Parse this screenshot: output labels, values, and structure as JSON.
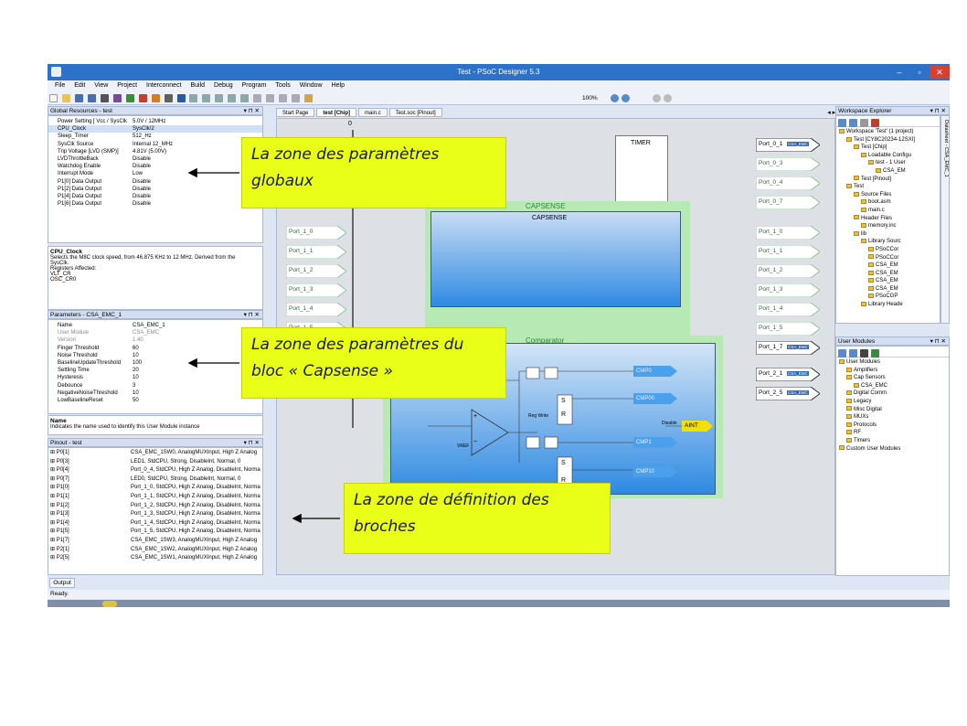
{
  "window": {
    "title": "Test - PSoC Designer 5.3",
    "min": "–",
    "max": "▫",
    "close": "✕"
  },
  "menu": [
    "File",
    "Edit",
    "View",
    "Project",
    "Interconnect",
    "Build",
    "Debug",
    "Program",
    "Tools",
    "Window",
    "Help"
  ],
  "toolbar": {
    "zoom": "100%"
  },
  "global": {
    "title": "Global Resources - test",
    "controls": "▾ ⊓ ✕",
    "rows": [
      {
        "k": "Power Setting [ Vcc / SysClk",
        "v": "5.0V / 12MHz"
      },
      {
        "k": "CPU_Clock",
        "v": "SysClk/2"
      },
      {
        "k": "Sleep_Timer",
        "v": "512_Hz"
      },
      {
        "k": "SysClk Source",
        "v": "Internal 12_MHz"
      },
      {
        "k": "Trip Voltage [LVD (SMP)]",
        "v": "4.81V (5.00V)"
      },
      {
        "k": "LVDThrottleBack",
        "v": "Disable"
      },
      {
        "k": "Watchdog Enable",
        "v": "Disable"
      },
      {
        "k": "Interrupt Mode",
        "v": "Low"
      },
      {
        "k": "P1[0] Data Output",
        "v": "Disable"
      },
      {
        "k": "P1[2] Data Output",
        "v": "Disable"
      },
      {
        "k": "P1[4] Data Output",
        "v": "Disable"
      },
      {
        "k": "P1[6] Data Output",
        "v": "Disable"
      }
    ],
    "desc_title": "CPU_Clock",
    "desc_lines": [
      "Selects the M8C clock speed, from 46.875 KHz to 12 MHz. Derived from the",
      "SysClk.",
      "Registers Affected:",
      "VLT_CR",
      "OSC_CR0"
    ]
  },
  "params": {
    "title": "Parameters - CSA_EMC_1",
    "controls": "▾ ⊓ ✕",
    "rows": [
      {
        "k": "Name",
        "v": "CSA_EMC_1"
      },
      {
        "k": "User Module",
        "v": "CSA_EMC"
      },
      {
        "k": "Version",
        "v": "1.40"
      },
      {
        "k": "Finger Threshold",
        "v": "60"
      },
      {
        "k": "Noise Threshold",
        "v": "10"
      },
      {
        "k": "BaselineUpdateThreshold",
        "v": "100"
      },
      {
        "k": "Settling Time",
        "v": "20"
      },
      {
        "k": "Hysteresis",
        "v": "10"
      },
      {
        "k": "Debounce",
        "v": "3"
      },
      {
        "k": "NegativeNoiseThreshold",
        "v": "10"
      },
      {
        "k": "LowBaselineReset",
        "v": "50"
      }
    ],
    "desc_title": "Name",
    "desc_line": "Indicates the name used to identify this User Module instance"
  },
  "pinout": {
    "title": "Pinout - test",
    "controls": "▾ ⊓ ✕",
    "rows": [
      {
        "k": "⊞  P0[1]",
        "v": "CSA_EMC_1SW0, AnalogMUXInput, High Z Analog"
      },
      {
        "k": "⊞  P0[3]",
        "v": "LED1, StdCPU, Strong, DisableInt, Normal, 0"
      },
      {
        "k": "⊞  P0[4]",
        "v": "Port_0_4, StdCPU, High Z Analog, DisableInt, Norma"
      },
      {
        "k": "⊞  P0[7]",
        "v": "LED0, StdCPU, Strong, DisableInt, Normal, 0"
      },
      {
        "k": "⊞  P1[0]",
        "v": "Port_1_0, StdCPU, High Z Analog, DisableInt, Norma"
      },
      {
        "k": "⊞  P1[1]",
        "v": "Port_1_1, StdCPU, High Z Analog, DisableInt, Norma"
      },
      {
        "k": "⊞  P1[2]",
        "v": "Port_1_2, StdCPU, High Z Analog, DisableInt, Norma"
      },
      {
        "k": "⊞  P1[3]",
        "v": "Port_1_3, StdCPU, High Z Analog, DisableInt, Norma"
      },
      {
        "k": "⊞  P1[4]",
        "v": "Port_1_4, StdCPU, High Z Analog, DisableInt, Norma"
      },
      {
        "k": "⊞  P1[5]",
        "v": "Port_1_5, StdCPU, High Z Analog, DisableInt, Norma"
      },
      {
        "k": "⊞  P1[7]",
        "v": "CSA_EMC_1SW3, AnalogMUXInput, High Z Analog"
      },
      {
        "k": "⊞  P2[1]",
        "v": "CSA_EMC_1SW2, AnalogMUXInput, High Z Analog"
      },
      {
        "k": "⊞  P2[5]",
        "v": "CSA_EMC_1SW1, AnalogMUXInput, High Z Analog"
      }
    ]
  },
  "tabs": [
    "Start Page",
    "test [Chip]",
    "main.c",
    "Test.soc [Pinout]"
  ],
  "tab_nav": "◂ ▸ ✕",
  "chip": {
    "timer": "TIMER",
    "capsense_outer": "CAPSENSE",
    "capsense_inner": "CAPSENSE",
    "comparator": "Comparator",
    "zero": "0",
    "left_ports": [
      "Port_1_0",
      "Port_1_1",
      "Port_1_2",
      "Port_1_3",
      "Port_1_4",
      "Port_1_5"
    ],
    "right_ports": [
      {
        "label": "Port_0_1",
        "tag": "CSA_EMC"
      },
      {
        "label": "Port_0_3",
        "tag": ""
      },
      {
        "label": "Port_0_4",
        "tag": ""
      },
      {
        "label": "Port_0_7",
        "tag": ""
      },
      {
        "label": "Port_1_0",
        "tag": ""
      },
      {
        "label": "Port_1_1",
        "tag": ""
      },
      {
        "label": "Port_1_2",
        "tag": ""
      },
      {
        "label": "Port_1_3",
        "tag": ""
      },
      {
        "label": "Port_1_4",
        "tag": ""
      },
      {
        "label": "Port_1_5",
        "tag": ""
      },
      {
        "label": "Port_1_7",
        "tag": "CSA_EMC"
      },
      {
        "label": "Port_2_1",
        "tag": "CSA_EMC"
      },
      {
        "label": "Port_2_5",
        "tag": "CSA_EMC"
      }
    ],
    "cmp": [
      "CMP0",
      "CMP00",
      "CMP1",
      "CMP10"
    ],
    "aint": "AINT",
    "disable": "Disable",
    "s1": "S",
    "r1": "R",
    "s2": "S",
    "r2": "R",
    "regwrite": "Reg Write",
    "vref": "VREF",
    "plus": "+",
    "minus": "−"
  },
  "workspace": {
    "title": "Workspace Explorer",
    "controls": "▾ ⊓ ✕",
    "side": "Datasheet - CSA_EMC_1",
    "items": [
      {
        "t": "Workspace 'Test' (1 project)",
        "d": 0
      },
      {
        "t": "Test [CY8C20234-12SXI]",
        "d": 1
      },
      {
        "t": "Test [Chip]",
        "d": 2
      },
      {
        "t": "Loadable Configu",
        "d": 3
      },
      {
        "t": "test - 1 User",
        "d": 4
      },
      {
        "t": "CSA_EM",
        "d": 5
      },
      {
        "t": "Test [Pinout]",
        "d": 2
      },
      {
        "t": "Test",
        "d": 1
      },
      {
        "t": "Source Files",
        "d": 2
      },
      {
        "t": "boot.asm",
        "d": 3
      },
      {
        "t": "main.c",
        "d": 3
      },
      {
        "t": "Header Files",
        "d": 2
      },
      {
        "t": "memory.inc",
        "d": 3
      },
      {
        "t": "lib",
        "d": 2
      },
      {
        "t": "Library Sourc",
        "d": 3
      },
      {
        "t": "PSoCCor",
        "d": 4
      },
      {
        "t": "PSoCCor",
        "d": 4
      },
      {
        "t": "CSA_EM",
        "d": 4
      },
      {
        "t": "CSA_EM",
        "d": 4
      },
      {
        "t": "CSA_EM",
        "d": 4
      },
      {
        "t": "CSA_EM",
        "d": 4
      },
      {
        "t": "PSoCGP",
        "d": 4
      },
      {
        "t": "Library Heade",
        "d": 3
      }
    ]
  },
  "usermodules": {
    "title": "User Modules",
    "controls": "▾ ⊓ ✕",
    "items": [
      {
        "t": "User Modules",
        "d": 0
      },
      {
        "t": "Amplifiers",
        "d": 1
      },
      {
        "t": "Cap Sensors",
        "d": 1
      },
      {
        "t": "CSA_EMC",
        "d": 2
      },
      {
        "t": "Digital Comm",
        "d": 1
      },
      {
        "t": "Legacy",
        "d": 1
      },
      {
        "t": "Misc Digital",
        "d": 1
      },
      {
        "t": "MUXs",
        "d": 1
      },
      {
        "t": "Protocols",
        "d": 1
      },
      {
        "t": "RF",
        "d": 1
      },
      {
        "t": "Timers",
        "d": 1
      },
      {
        "t": "Custom User Modules",
        "d": 0
      }
    ]
  },
  "output_tab": "Output",
  "status": "Ready.",
  "callouts": {
    "global": [
      "La zone des paramètres",
      "globaux"
    ],
    "params": [
      "La zone des paramètres du",
      "bloc « Capsense »"
    ],
    "pins": [
      "La zone de définition des",
      "broches"
    ]
  },
  "colors": {
    "callout": "#e9ff18",
    "titlebar": "#2b72c8",
    "capsense_bg": "#b6e9b4",
    "port_green": "#2c6a3a"
  }
}
